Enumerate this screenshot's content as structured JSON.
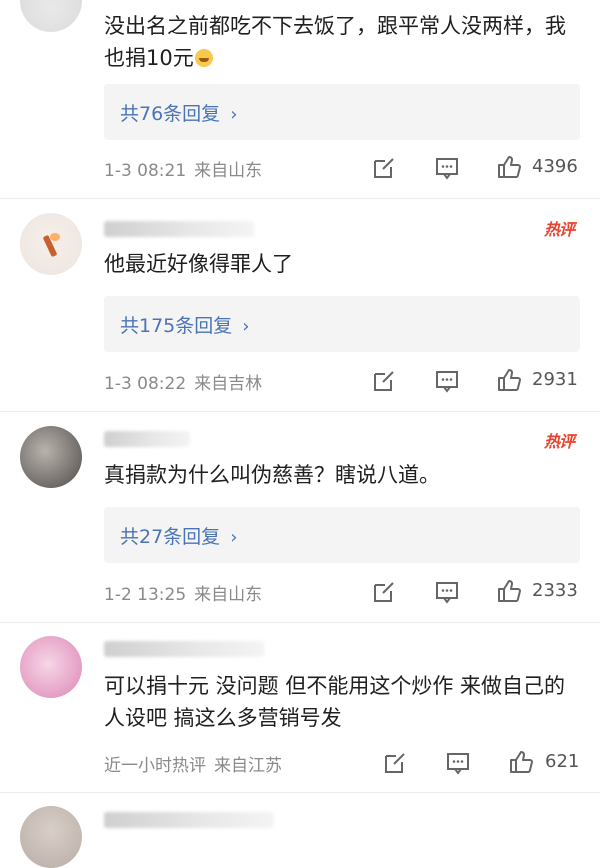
{
  "comments": [
    {
      "content": "没出名之前都吃不下去饭了，跟平常人没两样，我也捐10元",
      "replies": "共76条回复",
      "time": "1-3 08:21",
      "location": "来自山东",
      "likes": "4396"
    },
    {
      "badge": "热评",
      "content": "他最近好像得罪人了",
      "replies": "共175条回复",
      "time": "1-3 08:22",
      "location": "来自吉林",
      "likes": "2931"
    },
    {
      "badge": "热评",
      "content": "真捐款为什么叫伪慈善？瞎说八道。",
      "replies": "共27条回复",
      "time": "1-2 13:25",
      "location": "来自山东",
      "likes": "2333"
    },
    {
      "content": "可以捐十元 没问题 但不能用这个炒作 来做自己的人设吧 搞这么多营销号发",
      "time": "近一小时热评",
      "location": "来自江苏",
      "likes": "621"
    }
  ],
  "colors": {
    "link": "#4a74b6",
    "hot": "#e8432f",
    "meta": "#8a8a8a"
  },
  "icons": [
    "share-icon",
    "comment-icon",
    "like-icon",
    "chevron-right-icon"
  ]
}
